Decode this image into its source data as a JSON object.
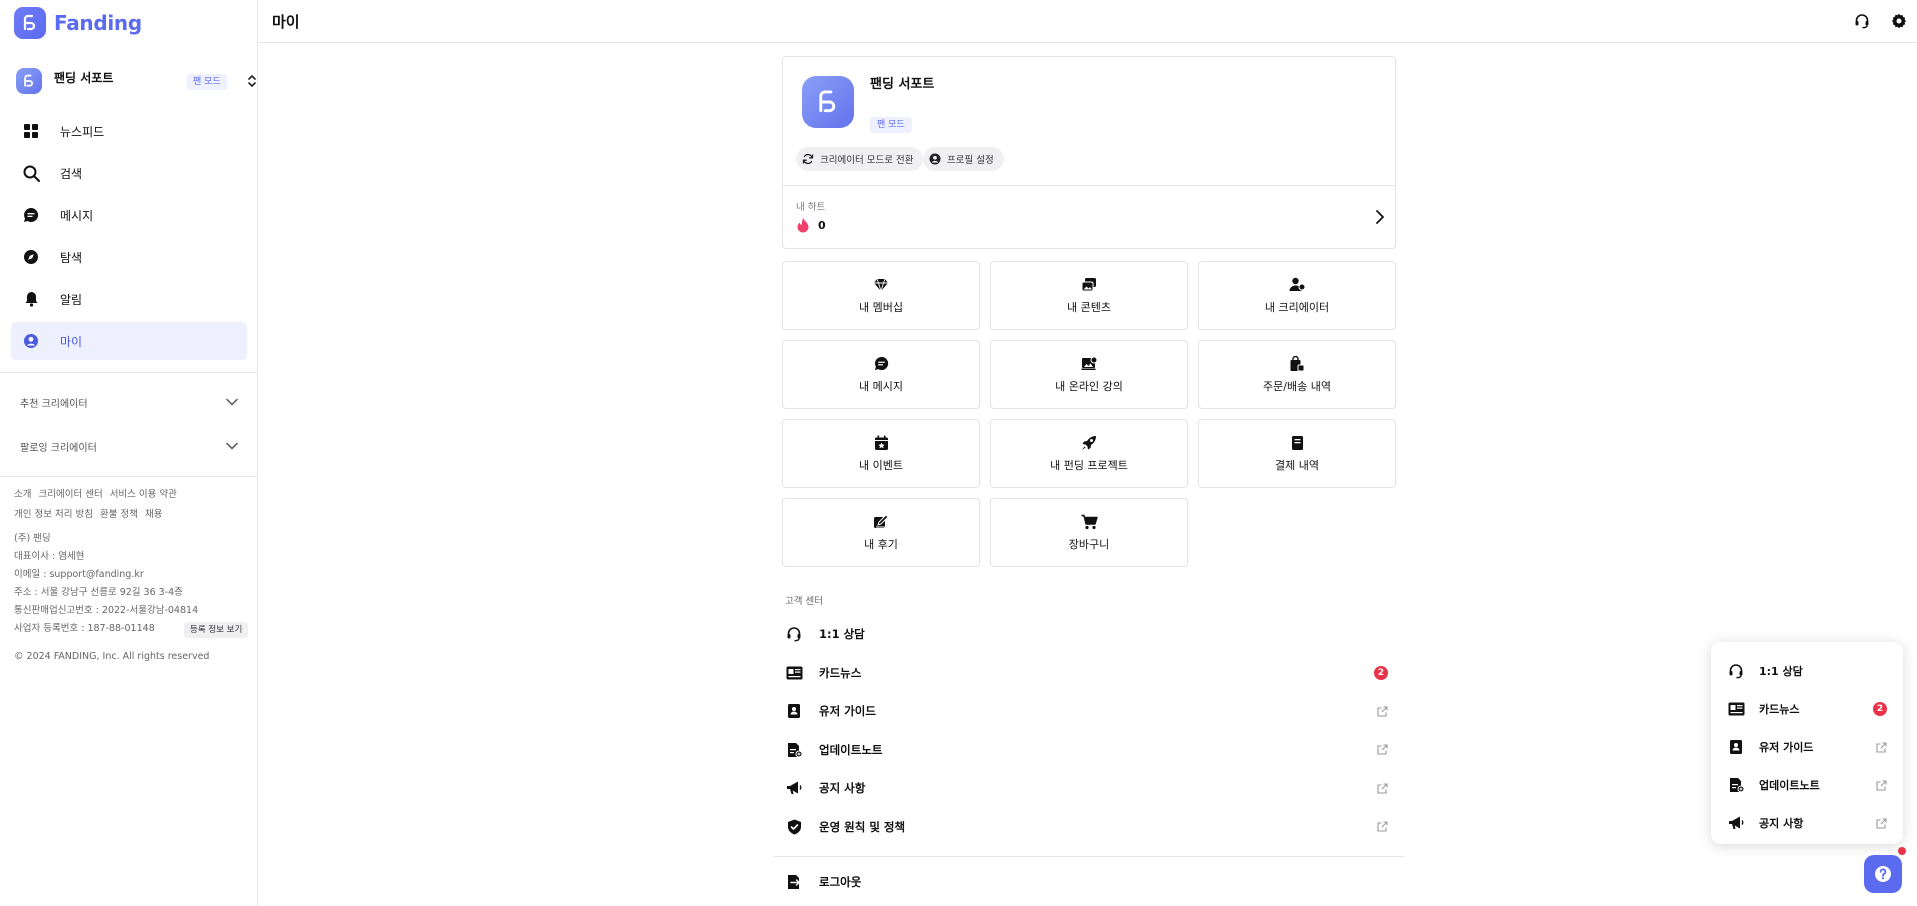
{
  "brand": {
    "name": "Fanding",
    "color": "#5b6bf0"
  },
  "sidebar": {
    "profile": {
      "name": "팬딩 서포트",
      "mode": "팬 모드"
    },
    "nav": [
      {
        "label": "뉴스피드",
        "icon": "grid-icon"
      },
      {
        "label": "검색",
        "icon": "search-icon"
      },
      {
        "label": "메시지",
        "icon": "chat-icon"
      },
      {
        "label": "탐색",
        "icon": "compass-icon"
      },
      {
        "label": "알림",
        "icon": "bell-icon"
      },
      {
        "label": "마이",
        "icon": "user-circle-icon",
        "active": true
      }
    ],
    "sections": [
      {
        "label": "추천 크리에이터"
      },
      {
        "label": "팔로잉 크리에이터"
      }
    ],
    "footer": {
      "links_row1": [
        "소개",
        "크리에이터 센터",
        "서비스 이용 약관"
      ],
      "links_row2": [
        "개인 정보 처리 방침",
        "환불 정책",
        "채용"
      ],
      "company": "(주) 팬딩",
      "ceo": "대표이사 : 염세현",
      "email": "이메일 : support@fanding.kr",
      "address": "주소 : 서울 강남구 선릉로 92길 36 3-4층",
      "telecom": "통신판매업신고번호 : 2022-서울강남-04814",
      "business": "사업자 등록번호 : 187-88-01148",
      "reg_button": "등록 정보 보기",
      "copyright": "© 2024 FANDING, Inc. All rights reserved"
    }
  },
  "header": {
    "title": "마이"
  },
  "profile_card": {
    "name": "팬딩 서포트",
    "mode": "팬 모드",
    "switch_button": "크리에이터 모드로 전환",
    "settings_button": "프로필 설정",
    "heart_label": "내 하트",
    "heart_count": "0"
  },
  "tiles": [
    {
      "label": "내 멤버십",
      "icon": "diamond-icon"
    },
    {
      "label": "내 콘텐츠",
      "icon": "images-icon"
    },
    {
      "label": "내 크리에이터",
      "icon": "creator-icon"
    },
    {
      "label": "내 메시지",
      "icon": "chat-icon"
    },
    {
      "label": "내 온라인 강의",
      "icon": "lecture-icon"
    },
    {
      "label": "주문/배송 내역",
      "icon": "shopping-bag-icon"
    },
    {
      "label": "내 이벤트",
      "icon": "calendar-star-icon"
    },
    {
      "label": "내 펀딩 프로젝트",
      "icon": "rocket-icon"
    },
    {
      "label": "결제 내역",
      "icon": "receipt-icon"
    },
    {
      "label": "내 후기",
      "icon": "review-icon"
    },
    {
      "label": "장바구니",
      "icon": "cart-icon"
    }
  ],
  "customer_center": {
    "title": "고객 센터",
    "items": [
      {
        "label": "1:1 상담",
        "icon": "headset-icon"
      },
      {
        "label": "카드뉴스",
        "icon": "card-news-icon",
        "badge": "2"
      },
      {
        "label": "유저 가이드",
        "icon": "user-guide-icon",
        "external": true
      },
      {
        "label": "업데이트노트",
        "icon": "update-note-icon",
        "external": true
      },
      {
        "label": "공지 사항",
        "icon": "megaphone-icon",
        "external": true
      },
      {
        "label": "운영 원칙 및 정책",
        "icon": "shield-check-icon",
        "external": true
      }
    ],
    "logout": "로그아웃"
  },
  "help_panel": {
    "items": [
      {
        "label": "1:1 상담",
        "icon": "headset-icon"
      },
      {
        "label": "카드뉴스",
        "icon": "card-news-icon",
        "badge": "2"
      },
      {
        "label": "유저 가이드",
        "icon": "user-guide-icon",
        "external": true
      },
      {
        "label": "업데이트노트",
        "icon": "update-note-icon",
        "external": true
      },
      {
        "label": "공지 사항",
        "icon": "megaphone-icon",
        "external": true
      }
    ]
  }
}
